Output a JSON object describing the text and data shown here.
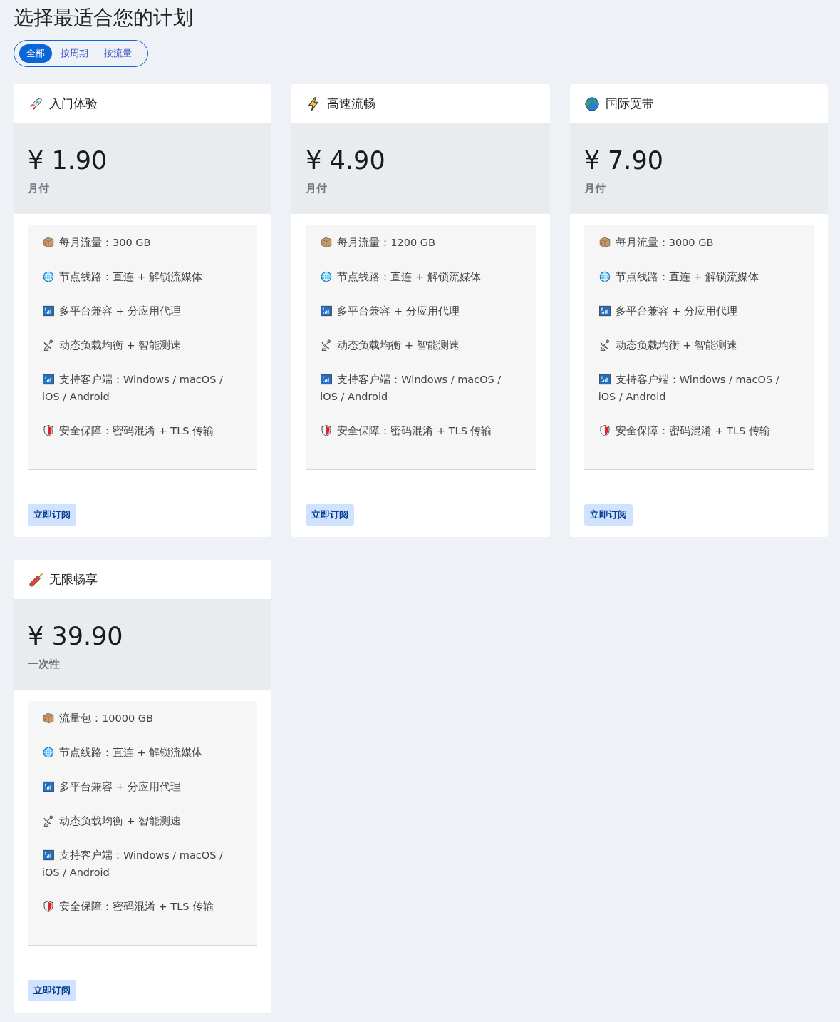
{
  "title": "选择最适合您的计划",
  "filters": [
    {
      "label": "全部",
      "selected": true
    },
    {
      "label": "按周期",
      "selected": false
    },
    {
      "label": "按流量",
      "selected": false
    }
  ],
  "plans": [
    {
      "kind": "rocket",
      "name": "入门体验",
      "price": "¥ 1.90",
      "period": "月付",
      "features": [
        {
          "kind": "box",
          "text": "每月流量：300 GB"
        },
        {
          "kind": "globe",
          "text": "节点线路：直连 + 解锁流媒体"
        },
        {
          "kind": "signal",
          "text": "多平台兼容 + 分应用代理"
        },
        {
          "kind": "satellite",
          "text": "动态负载均衡 + 智能测速"
        },
        {
          "kind": "signal",
          "text": "支持客户端：Windows / macOS / iOS / Android"
        },
        {
          "kind": "shield",
          "text": "安全保障：密码混淆 + TLS 传输"
        }
      ],
      "button": "立即订阅"
    },
    {
      "kind": "bolt",
      "name": "高速流畅",
      "price": "¥ 4.90",
      "period": "月付",
      "features": [
        {
          "kind": "box",
          "text": "每月流量：1200 GB"
        },
        {
          "kind": "globe",
          "text": "节点线路：直连 + 解锁流媒体"
        },
        {
          "kind": "signal",
          "text": "多平台兼容 + 分应用代理"
        },
        {
          "kind": "satellite",
          "text": "动态负载均衡 + 智能测速"
        },
        {
          "kind": "signal",
          "text": "支持客户端：Windows / macOS / iOS / Android"
        },
        {
          "kind": "shield",
          "text": "安全保障：密码混淆 + TLS 传输"
        }
      ],
      "button": "立即订阅"
    },
    {
      "kind": "earth",
      "name": "国际宽带",
      "price": "¥ 7.90",
      "period": "月付",
      "features": [
        {
          "kind": "box",
          "text": "每月流量：3000 GB"
        },
        {
          "kind": "globe",
          "text": "节点线路：直连 + 解锁流媒体"
        },
        {
          "kind": "signal",
          "text": "多平台兼容 + 分应用代理"
        },
        {
          "kind": "satellite",
          "text": "动态负载均衡 + 智能测速"
        },
        {
          "kind": "signal",
          "text": "支持客户端：Windows / macOS / iOS / Android"
        },
        {
          "kind": "shield",
          "text": "安全保障：密码混淆 + TLS 传输"
        }
      ],
      "button": "立即订阅"
    },
    {
      "kind": "firecracker",
      "name": "无限畅享",
      "price": "¥ 39.90",
      "period": "一次性",
      "features": [
        {
          "kind": "box",
          "text": "流量包：10000 GB"
        },
        {
          "kind": "globe",
          "text": "节点线路：直连 + 解锁流媒体"
        },
        {
          "kind": "signal",
          "text": "多平台兼容 + 分应用代理"
        },
        {
          "kind": "satellite",
          "text": "动态负载均衡 + 智能测速"
        },
        {
          "kind": "signal",
          "text": "支持客户端：Windows / macOS / iOS / Android"
        },
        {
          "kind": "shield",
          "text": "安全保障：密码混淆 + TLS 传输"
        }
      ],
      "button": "立即订阅"
    }
  ]
}
